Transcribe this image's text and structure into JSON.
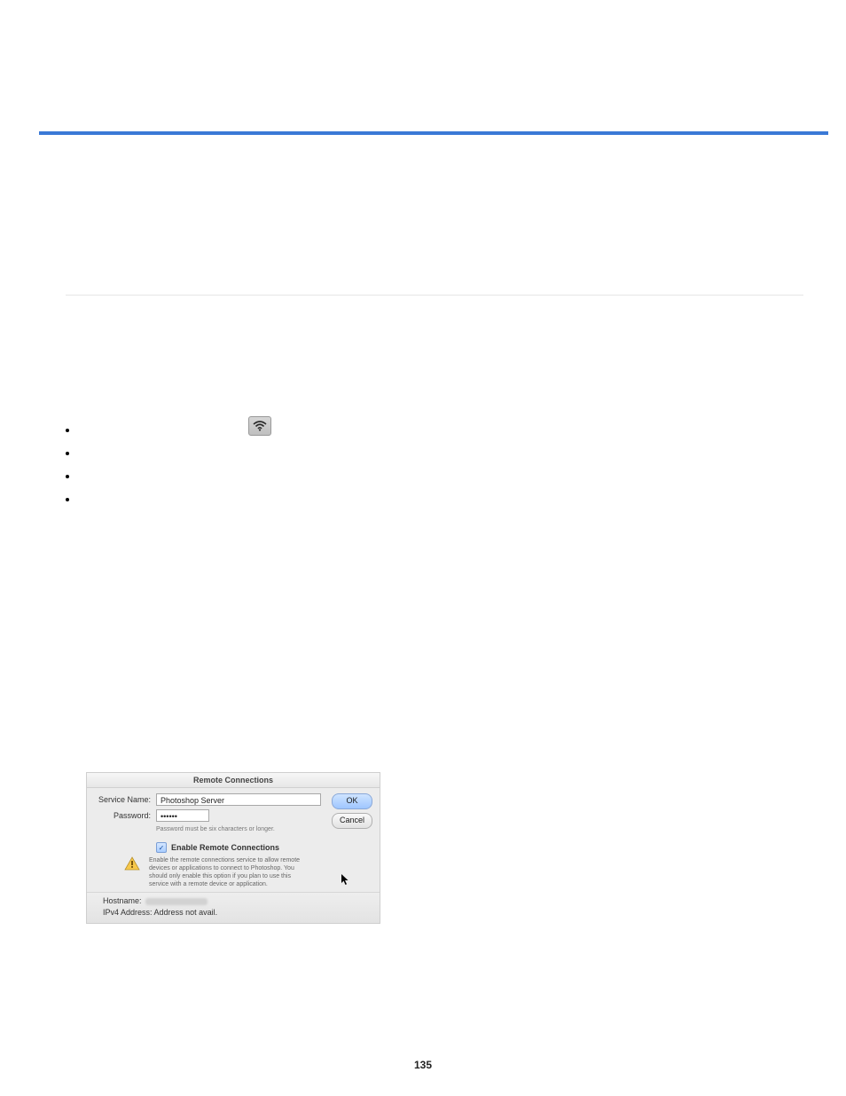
{
  "page_number": "135",
  "wifi_icon_name": "wifi-icon",
  "dialog": {
    "title": "Remote Connections",
    "service_name_label": "Service Name:",
    "service_name_value": "Photoshop Server",
    "password_label": "Password:",
    "password_value": "••••••",
    "password_hint": "Password must be six characters or longer.",
    "checkbox_label": "Enable Remote Connections",
    "warning_text": "Enable the remote connections service to allow remote devices or applications to connect to Photoshop. You should only enable this option if you plan to use this service with a remote device or application.",
    "ok_label": "OK",
    "cancel_label": "Cancel",
    "hostname_label": "Hostname:",
    "ipv4_label": "IPv4 Address:",
    "ipv4_value": "Address not avail."
  }
}
